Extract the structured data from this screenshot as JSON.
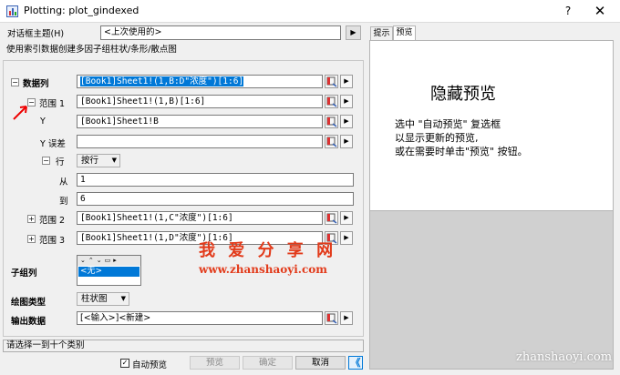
{
  "window": {
    "title": "Plotting: plot_gindexed",
    "help_label": "?",
    "close_label": "✕"
  },
  "theme": {
    "label": "对话框主题(H)",
    "value": "<上次使用的>",
    "go_label": "▶"
  },
  "description": "使用索引数据创建多因子组柱状/条形/散点图",
  "data_section": {
    "header": "数据列",
    "expander_minus": "⊟",
    "expander_plus": "⊞",
    "data_column_value": "[Book1]Sheet1!(1,B:D\"浓度\")[1:6]",
    "range1": {
      "label": "范围 1",
      "value": "[Book1]Sheet1!(1,B)[1:6]"
    },
    "y": {
      "label": "Y",
      "value": "[Book1]Sheet1!B"
    },
    "y_error": {
      "label": "Y 误差",
      "value": ""
    },
    "row": {
      "label": "行",
      "mode": "按行"
    },
    "from": {
      "label": "从",
      "value": "1"
    },
    "to": {
      "label": "到",
      "value": "6"
    },
    "range2": {
      "label": "范围 2",
      "value": "[Book1]Sheet1!(1,C\"浓度\")[1:6]"
    },
    "range3": {
      "label": "范围 3",
      "value": "[Book1]Sheet1!(1,D\"浓度\")[1:6]"
    },
    "subgroup": {
      "label": "子组列",
      "selected": "<无>"
    },
    "plot_type": {
      "label": "绘图类型",
      "value": "柱状图"
    },
    "output": {
      "label": "输出数据",
      "value": "[<输入>]<新建>"
    }
  },
  "status_message": "请选择一到十个类别",
  "footer": {
    "auto_preview_label": "自动预览",
    "auto_preview_checked": true,
    "preview_label": "预览",
    "ok_label": "确定",
    "cancel_label": "取消",
    "collapse_label": "《"
  },
  "right_panel": {
    "tabs": [
      "提示",
      "预览"
    ],
    "active_tab": 1,
    "preview_title": "隐藏预览",
    "preview_lines": [
      "选中 \"自动预览\" 复选框",
      "以显示更新的预览,",
      "或在需要时单击\"预览\" 按钮。"
    ],
    "bottom_color": "#d0d0d0"
  },
  "watermarks": {
    "site_cn": "我 爱 分 享 网",
    "site_url": "www.zhanshaoyi.com",
    "corner": "zhanshaoyi.com"
  },
  "colors": {
    "accent": "#0078d7",
    "watermark_red": "#e23a1a"
  }
}
